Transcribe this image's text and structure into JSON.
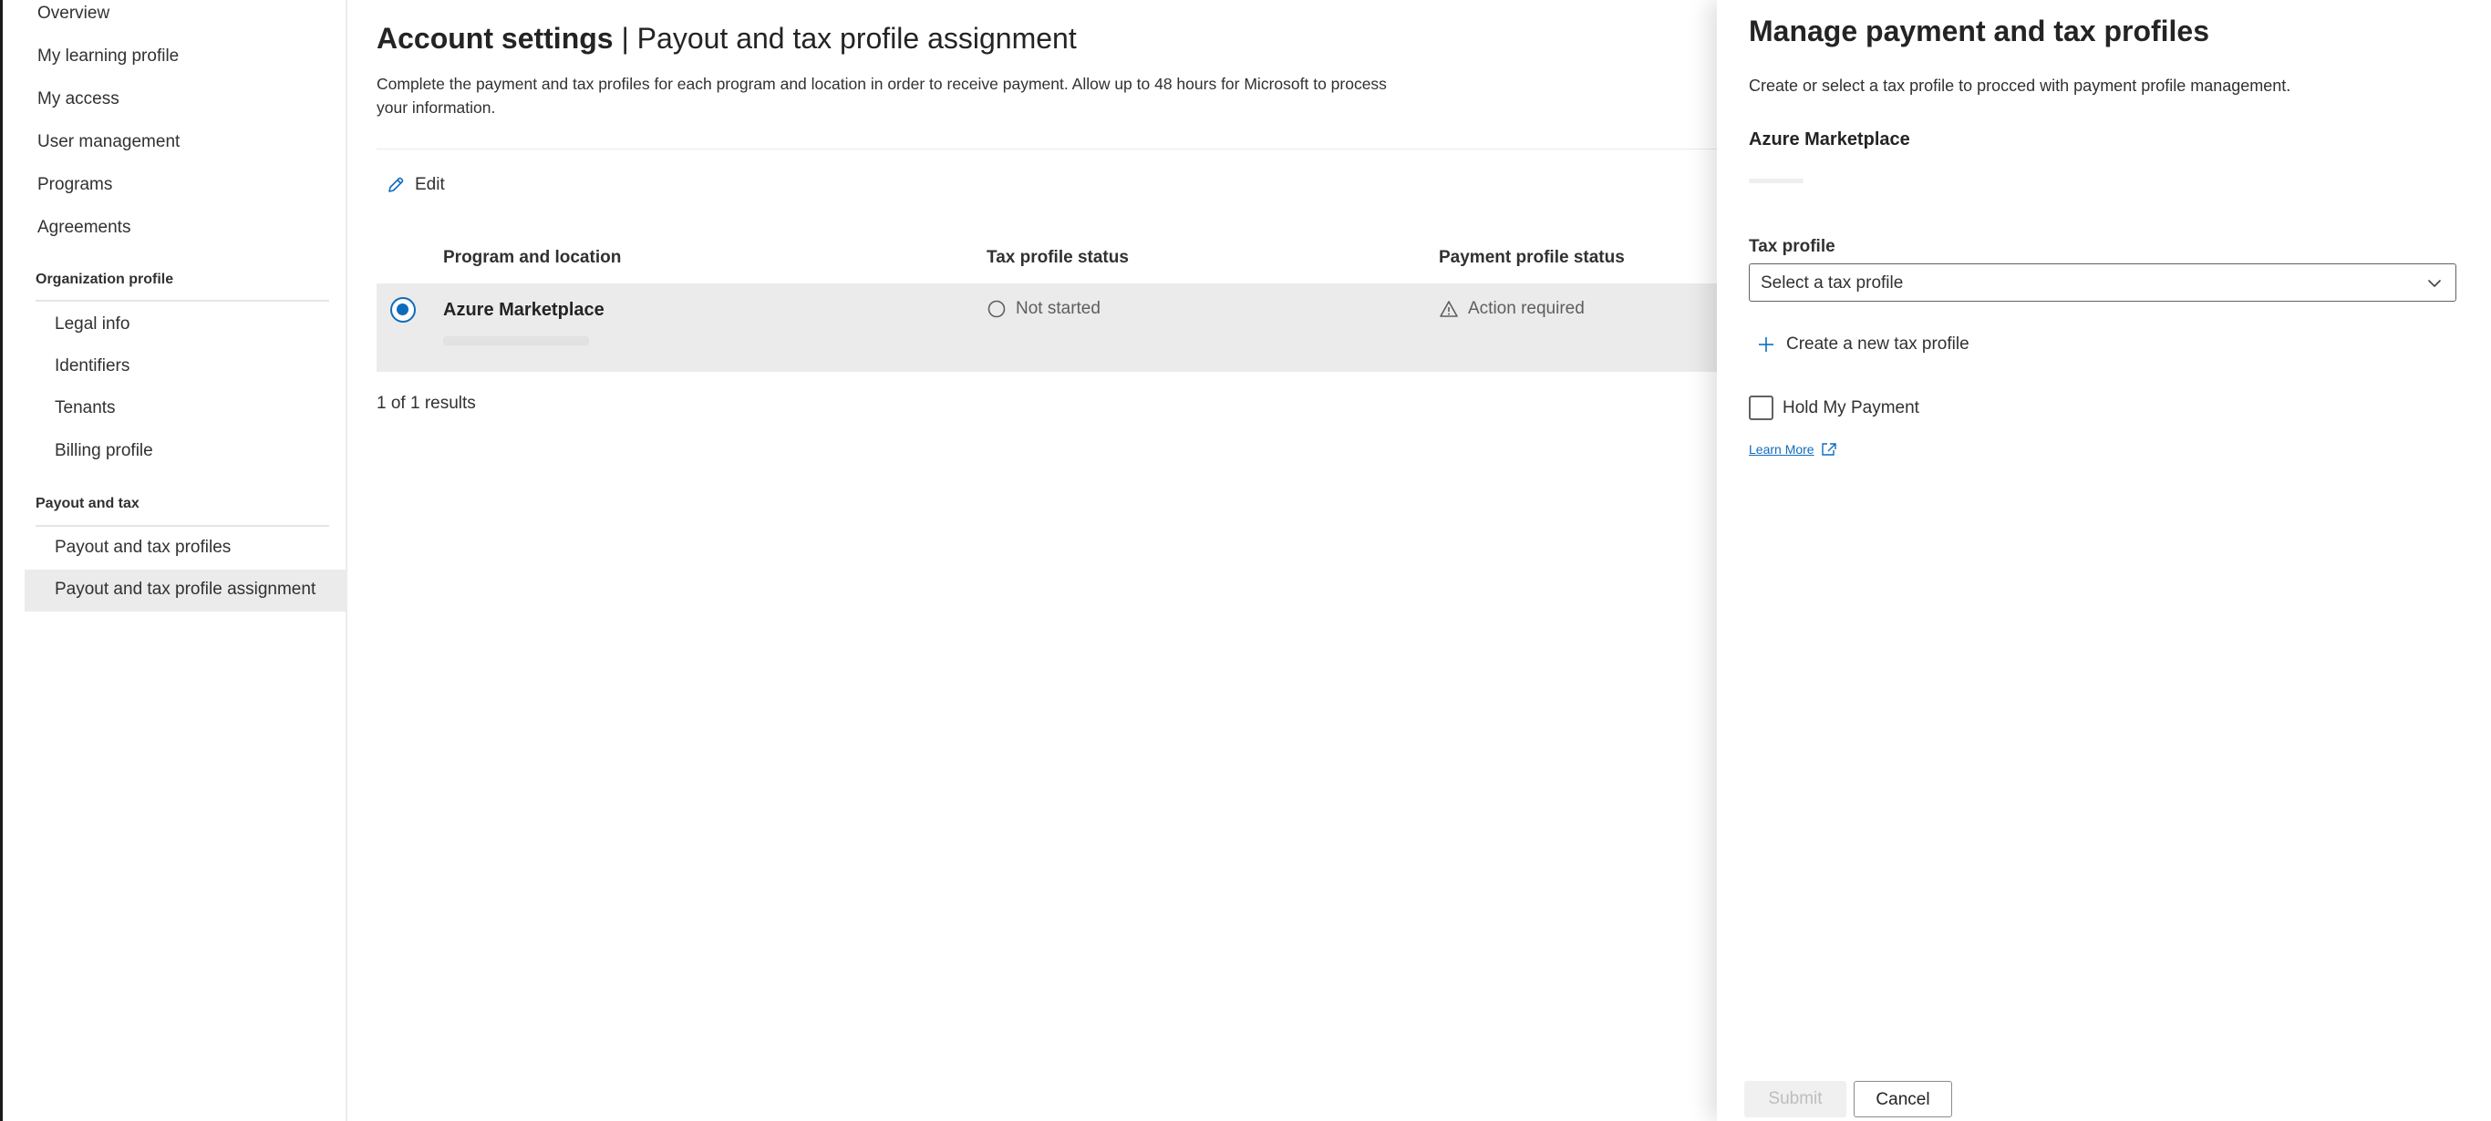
{
  "sidebar": {
    "items": [
      {
        "label": "Overview"
      },
      {
        "label": "My learning profile"
      },
      {
        "label": "My access"
      },
      {
        "label": "User management"
      },
      {
        "label": "Programs"
      },
      {
        "label": "Agreements"
      }
    ],
    "org_section": {
      "title": "Organization profile",
      "items": [
        {
          "label": "Legal info"
        },
        {
          "label": "Identifiers"
        },
        {
          "label": "Tenants"
        },
        {
          "label": "Billing profile"
        }
      ]
    },
    "payout_section": {
      "title": "Payout and tax",
      "items": [
        {
          "label": "Payout and tax profiles"
        },
        {
          "label": "Payout and tax profile assignment"
        }
      ]
    }
  },
  "main": {
    "title_bold": "Account settings",
    "title_sep": " | ",
    "title_page": "Payout and tax profile assignment",
    "description": "Complete the payment and tax profiles for each program and location in order to receive payment. Allow up to 48 hours for Microsoft to process your information.",
    "edit_label": "Edit",
    "table": {
      "columns": [
        "Program and location",
        "Tax profile status",
        "Payment profile status"
      ],
      "rows": [
        {
          "program": "Azure Marketplace",
          "tax_status": "Not started",
          "payment_status": "Action required"
        }
      ]
    },
    "results": "1 of 1 results"
  },
  "panel": {
    "title": "Manage payment and tax profiles",
    "description": "Create or select a tax profile to procced with payment profile management.",
    "program": "Azure Marketplace",
    "tax_profile_label": "Tax profile",
    "tax_profile_placeholder": "Select a tax profile",
    "create_label": "Create a new tax profile",
    "hold_label": "Hold My Payment",
    "learn_more": "Learn More",
    "submit_label": "Submit",
    "cancel_label": "Cancel"
  },
  "colors": {
    "accent": "#0f6cbd",
    "selected_row": "#ebebeb",
    "text": "#242424"
  },
  "icons": [
    "pencil-icon",
    "circle-outline-icon",
    "warning-icon",
    "chevron-down-icon",
    "plus-icon",
    "external-link-icon"
  ]
}
